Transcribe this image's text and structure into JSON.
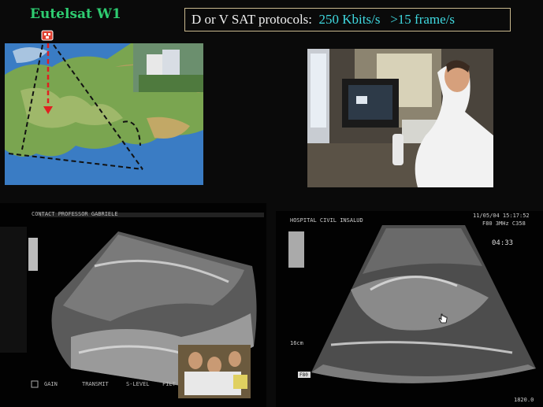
{
  "title": "Eutelsat W1",
  "protocol": {
    "prefix": "D or V SAT protocols:",
    "rate": "250 Kbits/s",
    "frames": ">15 frame/s"
  },
  "ultrasound_left": {
    "header": "CONTACT PROFESSOR GABRIELE",
    "footer": [
      "GAIN",
      "TRANSMIT",
      "S-LEVEL",
      "FILT"
    ]
  },
  "ultrasound_right": {
    "hospital": "HOSPITAL CIVIL INSALUD",
    "datetime": "11/05/04 15:17:52",
    "params": "F80  3MHz  C358",
    "timer": "04:33",
    "depth": "16cm",
    "footer_left": "F80",
    "footer_right": "1820.0"
  },
  "colors": {
    "title": "#2ecc71",
    "highlight": "#3fd9e0",
    "box_border": "#c9b98f"
  }
}
